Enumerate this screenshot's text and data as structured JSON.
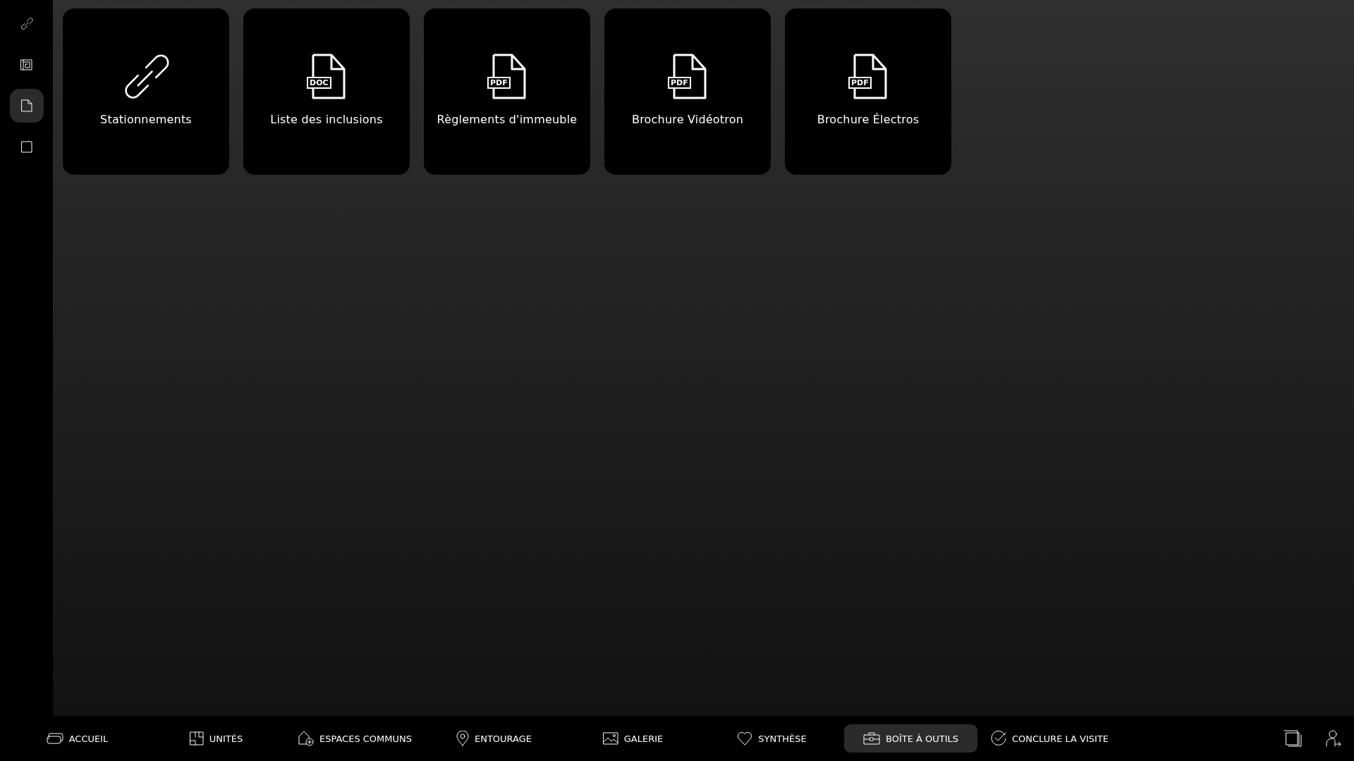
{
  "sidebar": {
    "items": [
      {
        "kind": "link",
        "selected": false
      },
      {
        "kind": "plan",
        "selected": false
      },
      {
        "kind": "document",
        "selected": true
      },
      {
        "kind": "folder",
        "selected": false
      }
    ]
  },
  "cards": [
    {
      "kind": "link",
      "label": "Stationnements"
    },
    {
      "kind": "file",
      "badge": "DOC",
      "label": "Liste des inclusions"
    },
    {
      "kind": "file",
      "badge": "PDF",
      "label": "Règlements d'immeuble"
    },
    {
      "kind": "file",
      "badge": "PDF",
      "label": "Brochure Vidéotron"
    },
    {
      "kind": "file",
      "badge": "PDF",
      "label": "Brochure Électros"
    }
  ],
  "bottom_nav": {
    "items": [
      {
        "kind": "home",
        "label": "ACCUEIL",
        "selected": false
      },
      {
        "kind": "unit",
        "label": "UNITÉS",
        "selected": false
      },
      {
        "kind": "common",
        "label": "ESPACES COMMUNS",
        "selected": false
      },
      {
        "kind": "pin",
        "label": "ENTOURAGE",
        "selected": false
      },
      {
        "kind": "gallery",
        "label": "GALERIE",
        "selected": false
      },
      {
        "kind": "heart",
        "label": "SYNTHÈSE",
        "selected": false
      },
      {
        "kind": "toolbox",
        "label": "BOÎTE À OUTILS",
        "selected": true
      },
      {
        "kind": "check",
        "label": "CONCLURE LA VISITE",
        "selected": false
      }
    ],
    "actions": [
      {
        "kind": "screens"
      },
      {
        "kind": "logout"
      }
    ]
  }
}
